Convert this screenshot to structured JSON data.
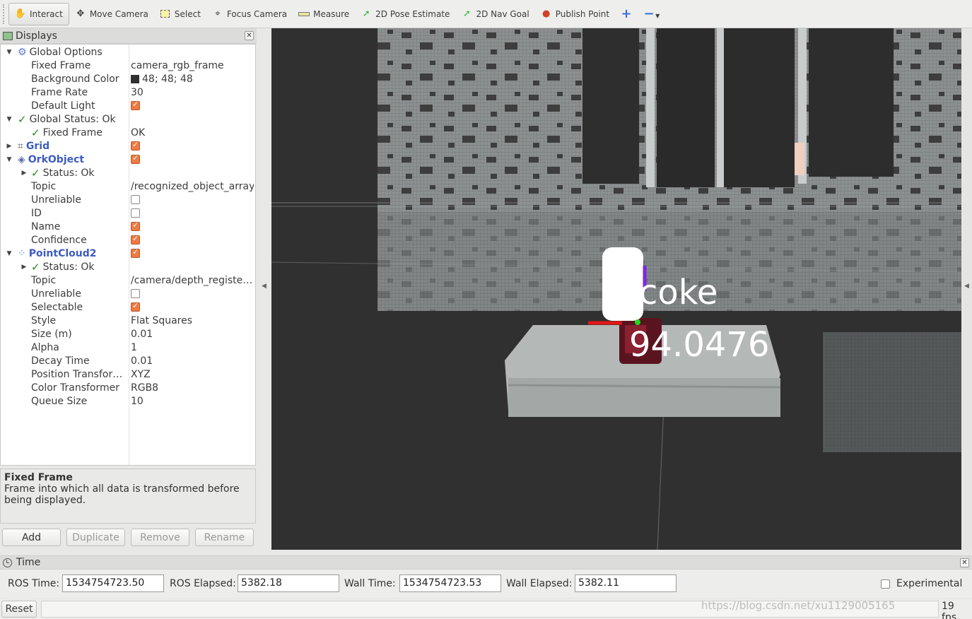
{
  "toolbar": {
    "items": [
      {
        "label": "Interact",
        "icon": "hand-icon"
      },
      {
        "label": "Move Camera",
        "icon": "move-camera-icon"
      },
      {
        "label": "Select",
        "icon": "select-box-icon"
      },
      {
        "label": "Focus Camera",
        "icon": "crosshair-icon"
      },
      {
        "label": "Measure",
        "icon": "ruler-icon"
      },
      {
        "label": "2D Pose Estimate",
        "icon": "green-arrow-icon"
      },
      {
        "label": "2D Nav Goal",
        "icon": "green-arrow-icon"
      },
      {
        "label": "Publish Point",
        "icon": "map-pin-icon"
      }
    ]
  },
  "displays": {
    "title": "Displays",
    "global_options": {
      "label": "Global Options",
      "fixed_frame_label": "Fixed Frame",
      "fixed_frame": "camera_rgb_frame",
      "background_label": "Background Color",
      "background": "48; 48; 48",
      "frame_rate_label": "Frame Rate",
      "frame_rate": "30",
      "default_light_label": "Default Light"
    },
    "global_status": {
      "label": "Global Status: Ok",
      "fixed_frame_label": "Fixed Frame",
      "fixed_frame": "OK"
    },
    "grid": {
      "label": "Grid"
    },
    "ork": {
      "label": "OrkObject",
      "status": "Status: Ok",
      "topic_label": "Topic",
      "topic": "/recognized_object_array",
      "unreliable_label": "Unreliable",
      "id_label": "ID",
      "name_label": "Name",
      "confidence_label": "Confidence"
    },
    "pc2": {
      "label": "PointCloud2",
      "status": "Status: Ok",
      "topic_label": "Topic",
      "topic": "/camera/depth_registe…",
      "unreliable_label": "Unreliable",
      "selectable_label": "Selectable",
      "style_label": "Style",
      "style": "Flat Squares",
      "size_label": "Size (m)",
      "size": "0.01",
      "alpha_label": "Alpha",
      "alpha": "1",
      "decay_label": "Decay Time",
      "decay": "0.01",
      "pos_label": "Position Transfor…",
      "pos": "XYZ",
      "color_label": "Color Transformer",
      "color": "RGB8",
      "queue_label": "Queue Size",
      "queue": "10"
    },
    "help": {
      "title": "Fixed Frame",
      "text": "Frame into which all data is transformed before being displayed."
    },
    "buttons": {
      "add": "Add",
      "duplicate": "Duplicate",
      "remove": "Remove",
      "rename": "Rename"
    }
  },
  "view": {
    "object_name": "coke",
    "confidence": "94.0476"
  },
  "time": {
    "title": "Time",
    "ros_time_label": "ROS Time:",
    "ros_time": "1534754723.50",
    "ros_elapsed_label": "ROS Elapsed:",
    "ros_elapsed": "5382.18",
    "wall_time_label": "Wall Time:",
    "wall_time": "1534754723.53",
    "wall_elapsed_label": "Wall Elapsed:",
    "wall_elapsed": "5382.11",
    "experimental_label": "Experimental"
  },
  "status": {
    "reset": "Reset",
    "fps": "19 fps",
    "watermark": "https://blog.csdn.net/xu1129005165"
  }
}
